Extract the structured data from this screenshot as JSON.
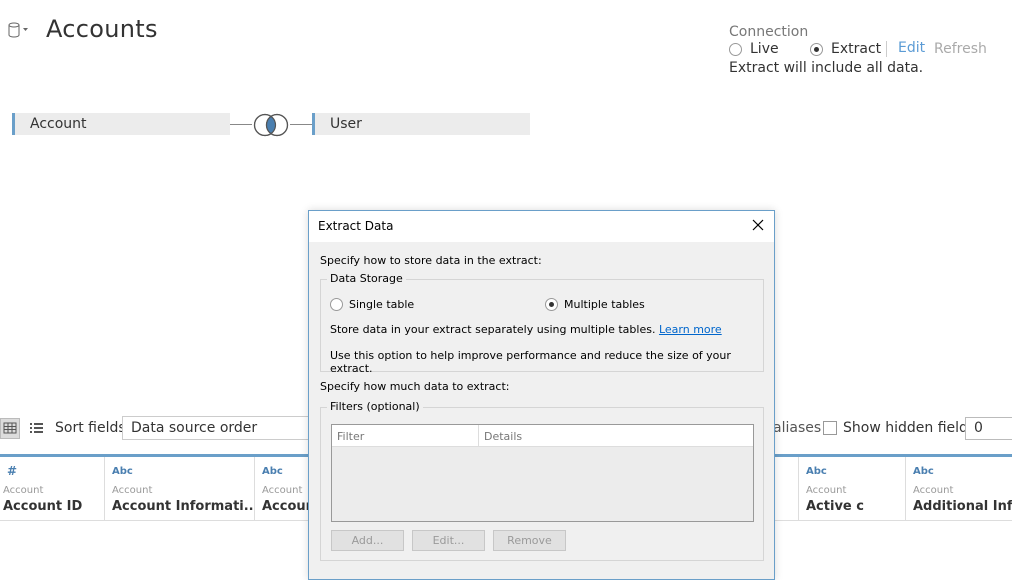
{
  "header": {
    "title": "Accounts"
  },
  "connection": {
    "label": "Connection",
    "live_label": "Live",
    "extract_label": "Extract",
    "selected": "Extract",
    "edit_label": "Edit",
    "refresh_label": "Refresh",
    "note": "Extract will include all data."
  },
  "join": {
    "left_table": "Account",
    "right_table": "User",
    "join_type": "inner"
  },
  "toolbar": {
    "sort_label": "Sort fields",
    "sort_value": "Data source order",
    "aliases_label": "aliases",
    "show_hidden_label": "Show hidden fields",
    "rows_value": "0"
  },
  "grid": {
    "columns": [
      {
        "type": "#",
        "source": "Account",
        "name": "Account ID"
      },
      {
        "type": "Abc",
        "source": "Account",
        "name": "Account Informati..."
      },
      {
        "type": "Abc",
        "source": "Account",
        "name": "Account"
      },
      {
        "type": "Abc",
        "source": "Account",
        "name": "Active c"
      },
      {
        "type": "Abc",
        "source": "Account",
        "name": "Additional Inform"
      }
    ]
  },
  "dialog": {
    "title": "Extract Data",
    "store_prompt": "Specify how to store data in the extract:",
    "storage_group": "Data Storage",
    "single_table": "Single table",
    "multiple_tables": "Multiple tables",
    "selected_storage": "Multiple tables",
    "storage_desc": "Store data in your extract separately using multiple tables.",
    "learn_more": "Learn more",
    "storage_hint": "Use this option to help improve performance and reduce the size of your extract.",
    "amount_prompt": "Specify how much data to extract:",
    "filters_group": "Filters (optional)",
    "filter_col": "Filter",
    "details_col": "Details",
    "add_btn": "Add...",
    "edit_btn": "Edit...",
    "remove_btn": "Remove"
  }
}
